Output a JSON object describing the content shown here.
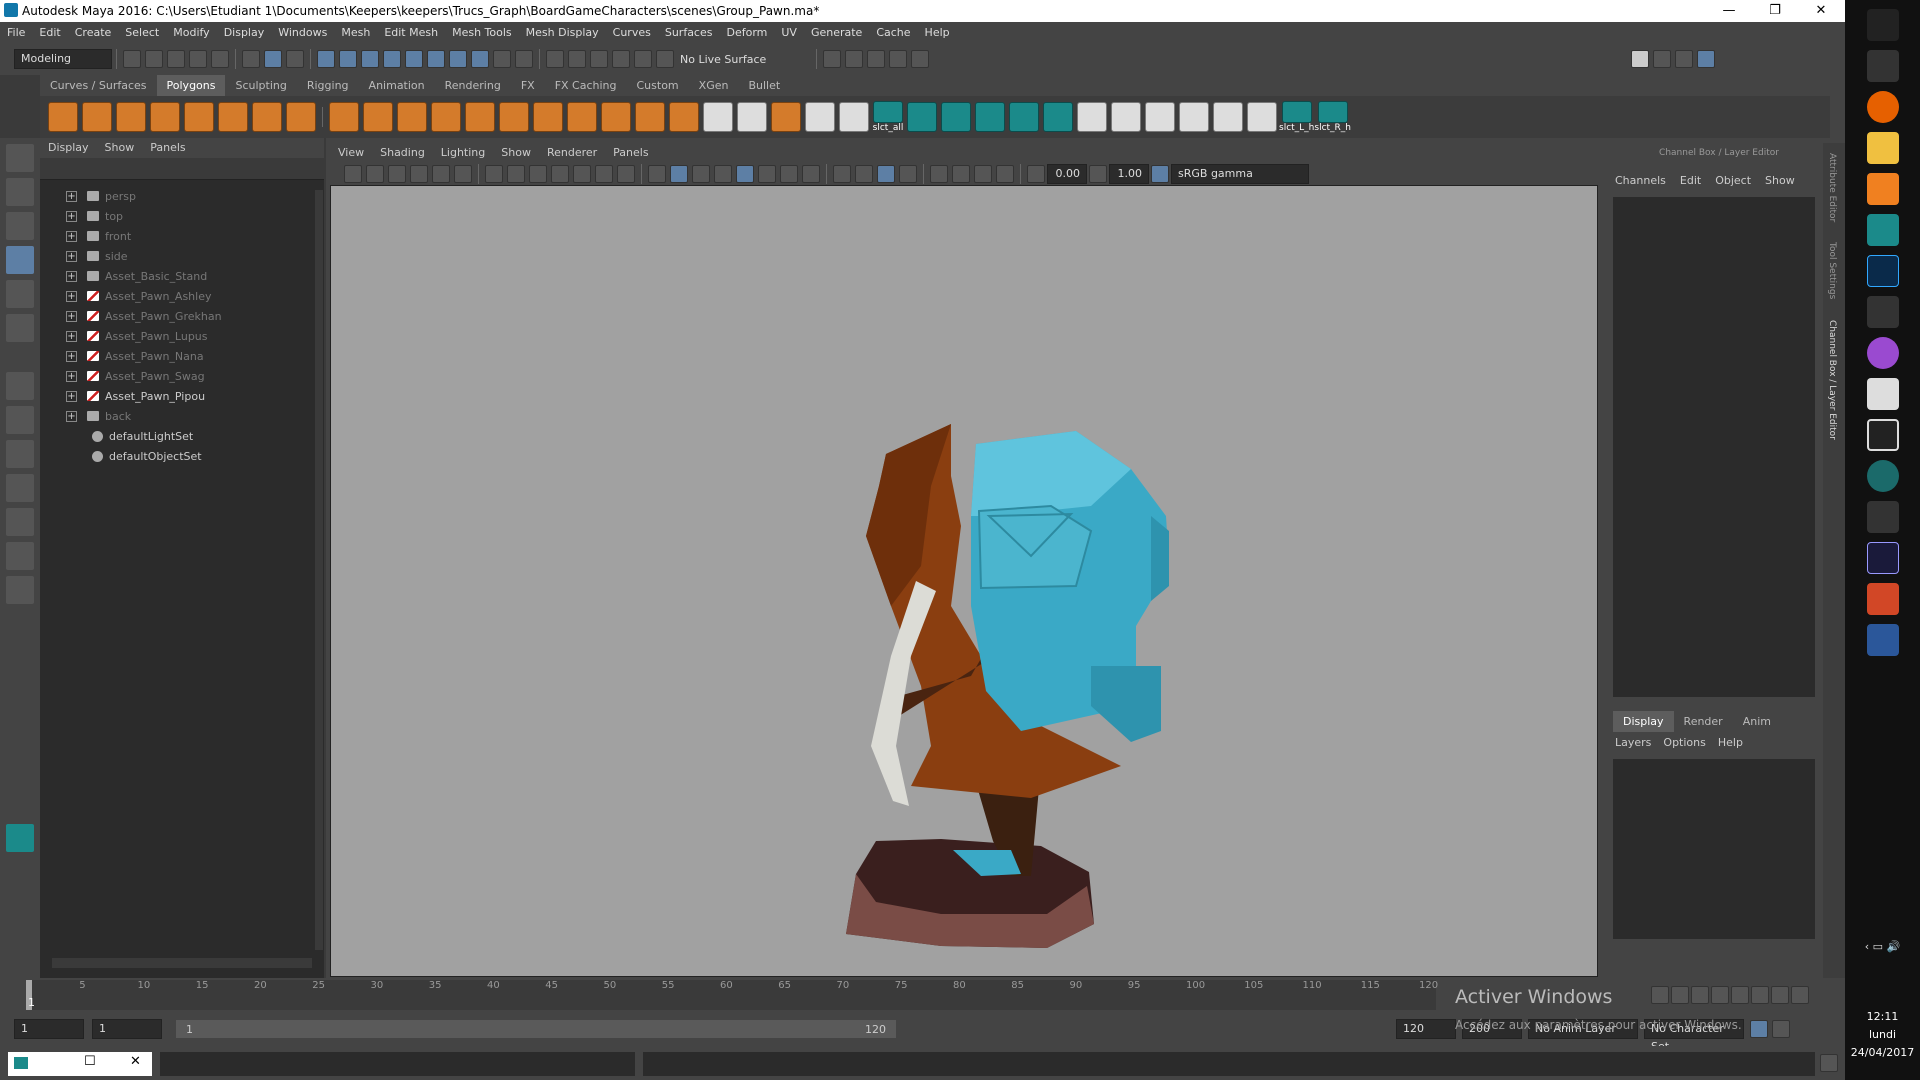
{
  "window": {
    "title": "Autodesk Maya 2016: C:\\Users\\Etudiant 1\\Documents\\Keepers\\keepers\\Trucs_Graph\\BoardGameCharacters\\scenes\\Group_Pawn.ma*"
  },
  "menu": [
    "File",
    "Edit",
    "Create",
    "Select",
    "Modify",
    "Display",
    "Windows",
    "Mesh",
    "Edit Mesh",
    "Mesh Tools",
    "Mesh Display",
    "Curves",
    "Surfaces",
    "Deform",
    "UV",
    "Generate",
    "Cache",
    "Help"
  ],
  "status": {
    "mode": "Modeling",
    "live_surface": "No Live Surface"
  },
  "shelf_tabs": [
    "Curves / Surfaces",
    "Polygons",
    "Sculpting",
    "Rigging",
    "Animation",
    "Rendering",
    "FX",
    "FX Caching",
    "Custom",
    "XGen",
    "Bullet"
  ],
  "shelf_labels": [
    "slct_all",
    "slct_L_h",
    "slct_R_h"
  ],
  "outliner": {
    "menu": [
      "Display",
      "Show",
      "Panels"
    ],
    "items": [
      {
        "label": "persp",
        "dim": true
      },
      {
        "label": "top",
        "dim": true
      },
      {
        "label": "front",
        "dim": true
      },
      {
        "label": "side",
        "dim": true
      },
      {
        "label": "Asset_Basic_Stand",
        "dim": true
      },
      {
        "label": "Asset_Pawn_Ashley",
        "dim": true
      },
      {
        "label": "Asset_Pawn_Grekhan",
        "dim": true
      },
      {
        "label": "Asset_Pawn_Lupus",
        "dim": true
      },
      {
        "label": "Asset_Pawn_Nana",
        "dim": true
      },
      {
        "label": "Asset_Pawn_Swag",
        "dim": true
      },
      {
        "label": "Asset_Pawn_Pipou",
        "dim": false
      },
      {
        "label": "back",
        "dim": true
      },
      {
        "label": "defaultLightSet",
        "dim": false
      },
      {
        "label": "defaultObjectSet",
        "dim": false
      }
    ]
  },
  "viewport": {
    "menu": [
      "View",
      "Shading",
      "Lighting",
      "Show",
      "Renderer",
      "Panels"
    ],
    "exposure": "0.00",
    "gamma": "1.00",
    "colorspace": "sRGB gamma"
  },
  "channel_box": {
    "title": "Channel Box / Layer Editor",
    "menu": [
      "Channels",
      "Edit",
      "Object",
      "Show"
    ],
    "tabs": [
      "Display",
      "Render",
      "Anim"
    ],
    "layer_menu": [
      "Layers",
      "Options",
      "Help"
    ],
    "side_tabs": [
      "Attribute Editor",
      "Tool Settings",
      "Channel Box / Layer Editor"
    ]
  },
  "timeline": {
    "ticks": [
      "5",
      "10",
      "15",
      "20",
      "25",
      "30",
      "35",
      "40",
      "45",
      "50",
      "55",
      "60",
      "65",
      "70",
      "75",
      "80",
      "85",
      "90",
      "95",
      "100",
      "105",
      "110",
      "115",
      "120"
    ],
    "current": "1",
    "start": "1",
    "playback_start": "1",
    "range_start": "1",
    "range_end": "120",
    "end": "120",
    "anim_end": "200",
    "anim_layer": "No Anim Layer",
    "char_set": "No Character Set"
  },
  "watermark": {
    "title": "Activer Windows",
    "sub": "Accédez aux paramètres pour activer Windows."
  },
  "clock": {
    "time": "12:11",
    "day": "lundi",
    "date": "24/04/2017"
  },
  "colors": {
    "panel": "#444444",
    "viewport": "#a1a1a1",
    "backpack": "#3aa9c6",
    "cloak": "#8a3e10",
    "accent": "#5d7fa5"
  }
}
